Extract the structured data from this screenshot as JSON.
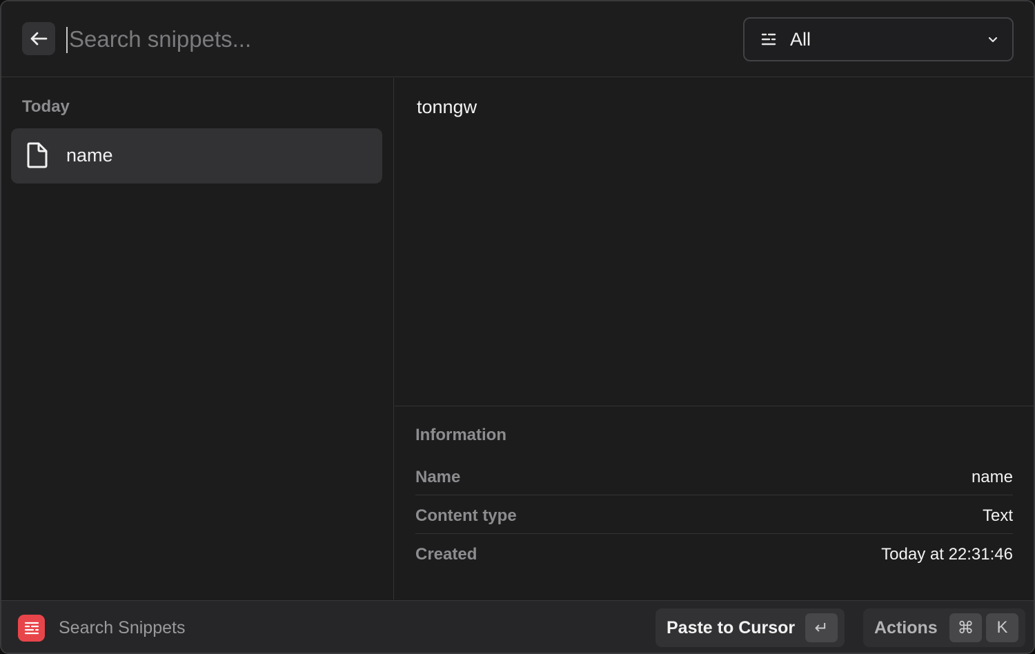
{
  "header": {
    "search_placeholder": "Search snippets...",
    "search_value": "",
    "filter_label": "All"
  },
  "list": {
    "section_title": "Today",
    "items": [
      {
        "label": "name",
        "icon": "document-icon",
        "selected": true
      }
    ]
  },
  "detail": {
    "preview_text": "tonngw",
    "info_title": "Information",
    "fields": [
      {
        "key": "Name",
        "value": "name"
      },
      {
        "key": "Content type",
        "value": "Text"
      },
      {
        "key": "Created",
        "value": "Today at 22:31:46"
      }
    ]
  },
  "footer": {
    "app_name": "Search Snippets",
    "primary_action_label": "Paste to Cursor",
    "primary_action_key": "↵",
    "actions_label": "Actions",
    "actions_keys": [
      "⌘",
      "K"
    ]
  },
  "colors": {
    "background": "#1c1c1d",
    "selected_item": "#323234",
    "app_icon": "#e8454a",
    "muted_text": "#8d8d90"
  }
}
